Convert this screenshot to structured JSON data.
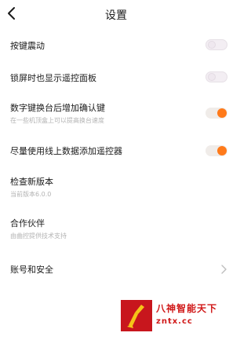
{
  "header": {
    "title": "设置"
  },
  "items": [
    {
      "label": "按键震动",
      "type": "toggle",
      "enabled": false
    },
    {
      "label": "锁屏时也显示遥控面板",
      "type": "toggle",
      "enabled": false
    },
    {
      "label": "数字键换台后增加确认键",
      "subtitle": "在一些机顶盒上可以提高换台速度",
      "type": "toggle",
      "enabled": true
    },
    {
      "label": "尽量使用线上数据添加遥控器",
      "type": "toggle",
      "enabled": true
    },
    {
      "label": "检查新版本",
      "subtitle": "当前版本6.0.0",
      "type": "info"
    },
    {
      "label": "合作伙伴",
      "subtitle": "由曲控提供技术支持",
      "type": "info"
    },
    {
      "label": "账号和安全",
      "type": "link"
    }
  ],
  "colors": {
    "accent": "#ff7a1a",
    "toggle_off": "#f3eef3",
    "subtitle": "#b3b3b3"
  },
  "watermark": {
    "line1": "八神智能天下",
    "line2": "zntx.cc"
  }
}
